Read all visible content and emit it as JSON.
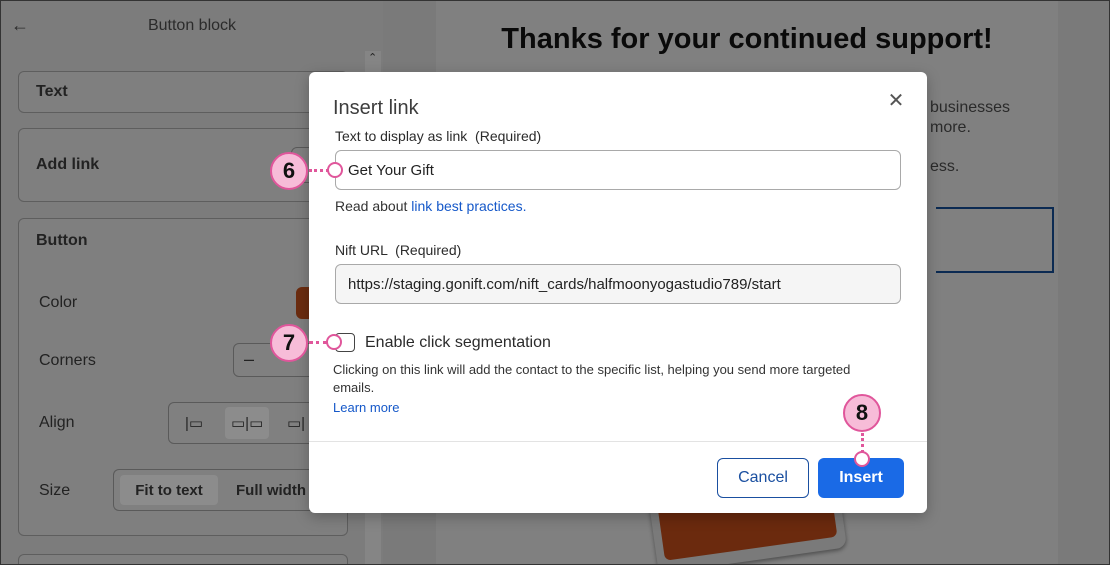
{
  "sidebar": {
    "back_icon": "arrow-left-icon",
    "title": "Button block",
    "sections": {
      "text": "Text",
      "add_link": "Add link",
      "button": "Button"
    },
    "rows": {
      "color": "Color",
      "corners": "Corners",
      "align": "Align",
      "size": "Size"
    },
    "align_options": [
      "|▭",
      "▭|▭",
      "▭|"
    ],
    "size_options": [
      "Fit to text",
      "Full width"
    ],
    "color_swatch": "#c2551c"
  },
  "preview": {
    "heading": "Thanks for your continued support!",
    "text_fragments": [
      "businesses",
      "more.",
      "ess."
    ]
  },
  "modal": {
    "title": "Insert link",
    "display_text_label": "Text to display as link  (Required)",
    "display_text_value": "Get Your Gift",
    "help_prefix": "Read about ",
    "help_link": "link best practices.",
    "url_label": "Nift URL  (Required)",
    "url_value": "https://staging.gonift.com/nift_cards/halfmoonyogastudio789/start",
    "segmentation_label": "Enable click segmentation",
    "segmentation_desc": "Clicking on this link will add the contact to the specific list, helping you send more targeted emails.",
    "learn_more": "Learn more",
    "cancel": "Cancel",
    "insert": "Insert",
    "close_icon": "close-icon"
  },
  "callouts": [
    "6",
    "7",
    "8"
  ],
  "colors": {
    "primary_button": "#1a6ae6",
    "link": "#1558c9",
    "callout_fill": "#f7bcd8",
    "callout_border": "#e0569b",
    "overlay": "#808080"
  }
}
